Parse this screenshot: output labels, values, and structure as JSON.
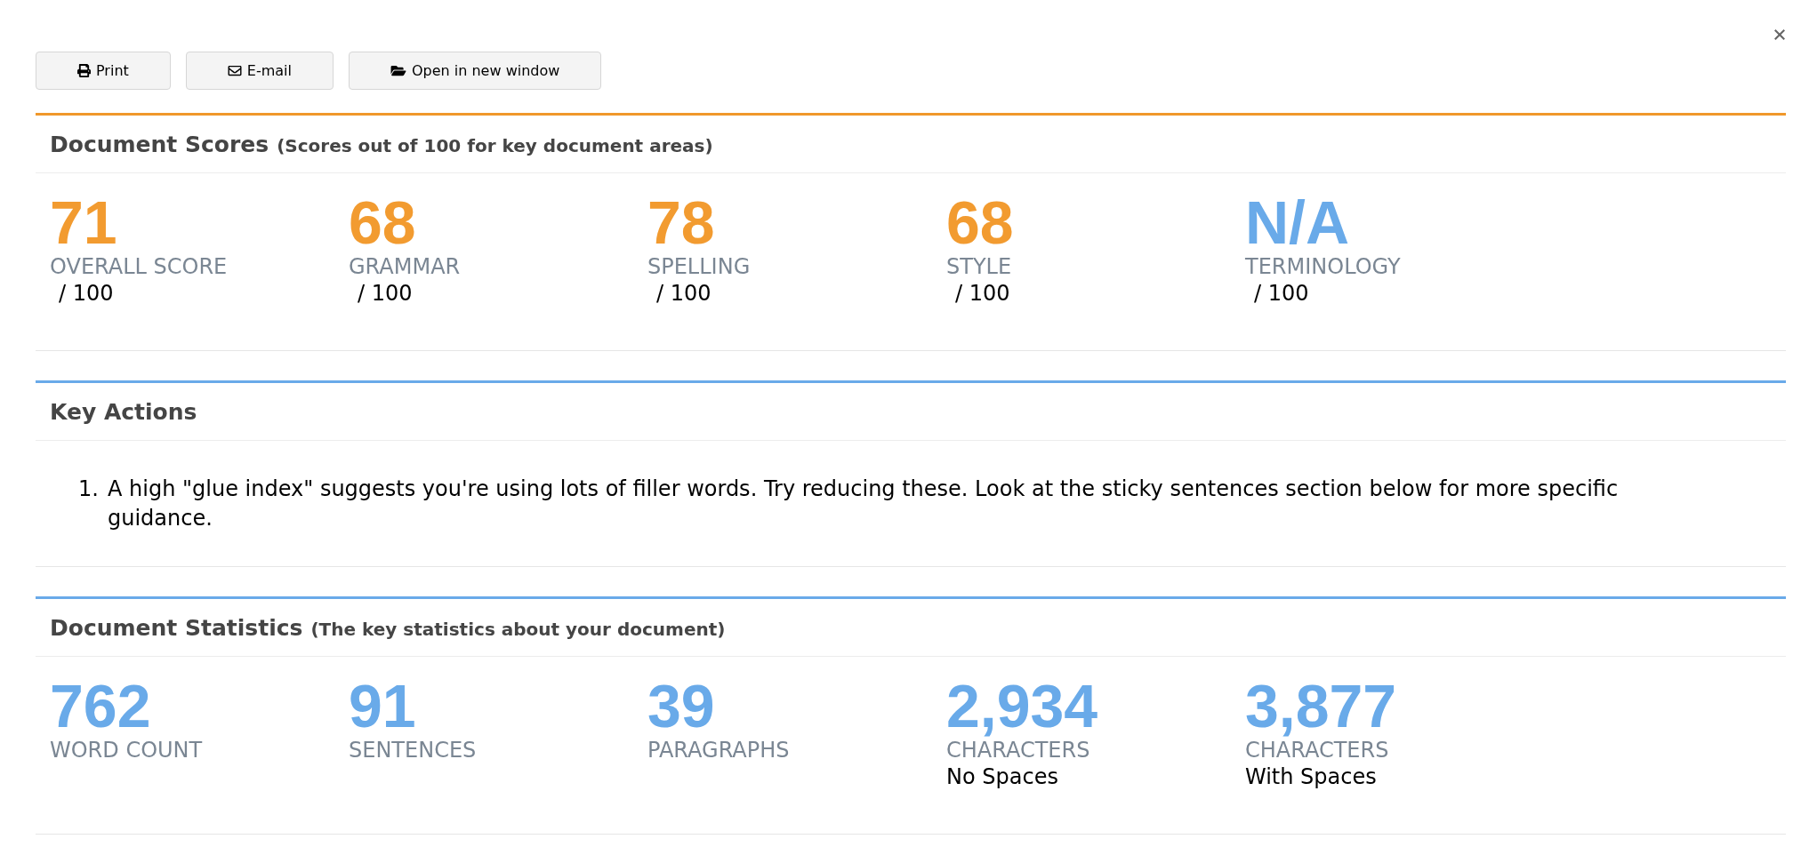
{
  "toolbar": {
    "buttons": [
      {
        "kind": "print",
        "label": "Print"
      },
      {
        "kind": "email",
        "label": "E-mail"
      },
      {
        "kind": "open",
        "label": "Open in new window"
      }
    ]
  },
  "sections": [
    {
      "kind": "metrics",
      "color": "#f0982b",
      "title": "Document Scores",
      "subtitle": "(Scores out of 100 for key document areas)",
      "items": [
        {
          "value": "71",
          "label": "OVERALL SCORE",
          "note": "/ 100",
          "color": "#f29b30"
        },
        {
          "value": "68",
          "label": "GRAMMAR",
          "note": "/ 100",
          "color": "#f29b30"
        },
        {
          "value": "78",
          "label": "SPELLING",
          "note": "/ 100",
          "color": "#f29b30"
        },
        {
          "value": "68",
          "label": "STYLE",
          "note": "/ 100",
          "color": "#f29b30"
        },
        {
          "value": "N/A",
          "label": "TERMINOLOGY",
          "note": "/ 100",
          "color": "#69aae9"
        }
      ]
    },
    {
      "kind": "list",
      "color": "#69aae9",
      "title": "Key Actions",
      "items": [
        {
          "number": "1.",
          "text": "A high \"glue index\" suggests you're using lots of filler words. Try reducing these. Look at the sticky sentences section below for more specific guidance."
        }
      ]
    },
    {
      "kind": "metrics",
      "color": "#69aae9",
      "title": "Document Statistics",
      "subtitle": "(The key statistics about your document)",
      "items": [
        {
          "value": "762",
          "label": "WORD COUNT",
          "color": "#69aae9"
        },
        {
          "value": "91",
          "label": "SENTENCES",
          "color": "#69aae9"
        },
        {
          "value": "39",
          "label": "PARAGRAPHS",
          "color": "#69aae9"
        },
        {
          "value": "2,934",
          "label": "CHARACTERS",
          "note": "No Spaces",
          "color": "#69aae9"
        },
        {
          "value": "3,877",
          "label": "CHARACTERS",
          "note": "With Spaces",
          "color": "#69aae9"
        }
      ]
    }
  ]
}
